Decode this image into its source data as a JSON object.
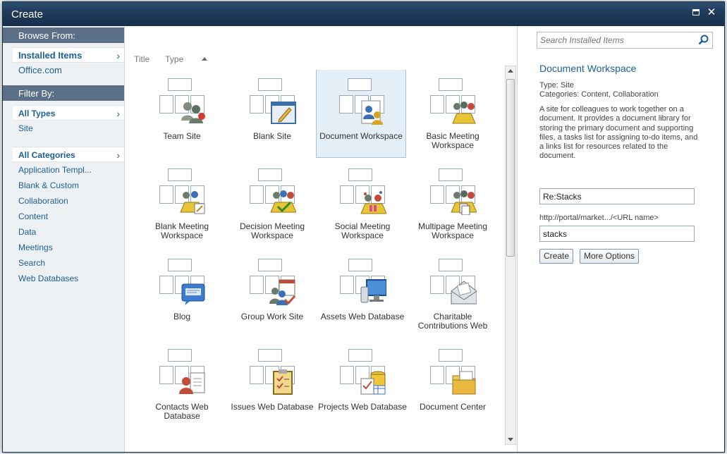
{
  "dialog": {
    "title": "Create"
  },
  "leftnav": {
    "browse_header": "Browse From:",
    "browse_items": [
      {
        "label": "Installed Items",
        "selected": true
      },
      {
        "label": "Office.com",
        "selected": false
      }
    ],
    "filter_header": "Filter By:",
    "type_items": [
      {
        "label": "All Types",
        "selected": true
      },
      {
        "label": "Site",
        "selected": false
      }
    ],
    "category_items": [
      {
        "label": "All Categories",
        "selected": true
      },
      {
        "label": "Application Templ...",
        "selected": false
      },
      {
        "label": "Blank & Custom",
        "selected": false
      },
      {
        "label": "Collaboration",
        "selected": false
      },
      {
        "label": "Content",
        "selected": false
      },
      {
        "label": "Data",
        "selected": false
      },
      {
        "label": "Meetings",
        "selected": false
      },
      {
        "label": "Search",
        "selected": false
      },
      {
        "label": "Web Databases",
        "selected": false
      }
    ]
  },
  "sort": {
    "title_label": "Title",
    "type_label": "Type"
  },
  "templates": [
    {
      "label": "Team Site",
      "icon": "team-site-icon"
    },
    {
      "label": "Blank Site",
      "icon": "blank-site-icon"
    },
    {
      "label": "Document Workspace",
      "icon": "document-workspace-icon",
      "selected": true
    },
    {
      "label": "Basic Meeting Workspace",
      "icon": "basic-meeting-icon"
    },
    {
      "label": "Blank Meeting Workspace",
      "icon": "blank-meeting-icon"
    },
    {
      "label": "Decision Meeting Workspace",
      "icon": "decision-meeting-icon"
    },
    {
      "label": "Social Meeting Workspace",
      "icon": "social-meeting-icon"
    },
    {
      "label": "Multipage Meeting Workspace",
      "icon": "multipage-meeting-icon"
    },
    {
      "label": "Blog",
      "icon": "blog-icon"
    },
    {
      "label": "Group Work Site",
      "icon": "group-work-icon"
    },
    {
      "label": "Assets Web Database",
      "icon": "assets-database-icon"
    },
    {
      "label": "Charitable Contributions Web",
      "icon": "charitable-icon"
    },
    {
      "label": "Contacts Web Database",
      "icon": "contacts-database-icon"
    },
    {
      "label": "Issues Web Database",
      "icon": "issues-database-icon"
    },
    {
      "label": "Projects Web Database",
      "icon": "projects-database-icon"
    },
    {
      "label": "Document Center",
      "icon": "document-center-icon"
    }
  ],
  "details": {
    "search_placeholder": "Search Installed Items",
    "title": "Document Workspace",
    "type_line": "Type: Site",
    "categories_line": "Categories: Content, Collaboration",
    "description": "A site for colleagues to work together on a document. It provides a document library for storing the primary document and supporting files, a tasks list for assigning to-do items, and a links list for resources related to the document.",
    "title_value": "Re:Stacks",
    "url_label": "http://portal/market.../<URL name>",
    "url_value": "stacks",
    "create_label": "Create",
    "more_options_label": "More Options"
  }
}
